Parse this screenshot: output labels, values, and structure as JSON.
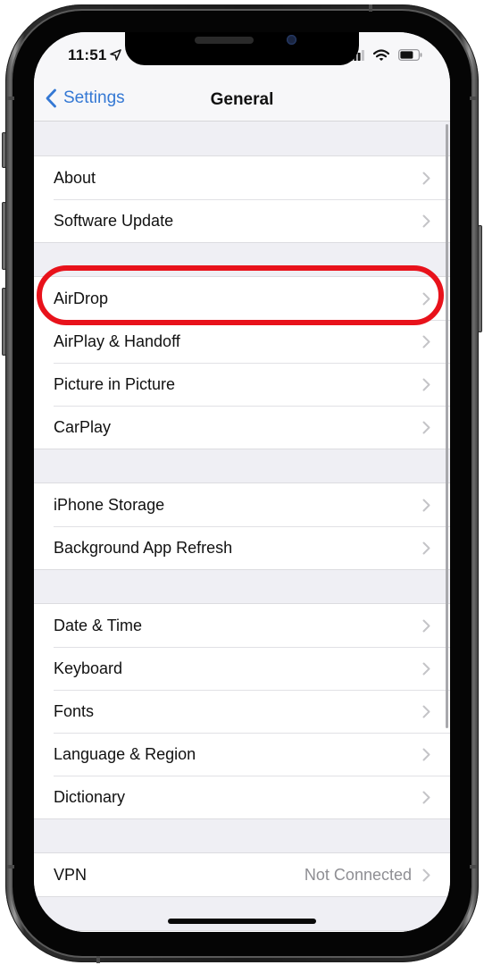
{
  "status_bar": {
    "time": "11:51",
    "location_icon": "location-arrow-icon",
    "signal_icon": "cellular-signal-icon",
    "wifi_icon": "wifi-icon",
    "battery_icon": "battery-icon"
  },
  "nav": {
    "back_label": "Settings",
    "back_icon": "chevron-left-icon",
    "title": "General"
  },
  "groups": [
    {
      "rows": [
        {
          "label": "About"
        },
        {
          "label": "Software Update"
        }
      ]
    },
    {
      "rows": [
        {
          "label": "AirDrop"
        },
        {
          "label": "AirPlay & Handoff"
        },
        {
          "label": "Picture in Picture"
        },
        {
          "label": "CarPlay"
        }
      ]
    },
    {
      "rows": [
        {
          "label": "iPhone Storage"
        },
        {
          "label": "Background App Refresh"
        }
      ]
    },
    {
      "rows": [
        {
          "label": "Date & Time"
        },
        {
          "label": "Keyboard"
        },
        {
          "label": "Fonts"
        },
        {
          "label": "Language & Region"
        },
        {
          "label": "Dictionary"
        }
      ]
    },
    {
      "rows": [
        {
          "label": "VPN",
          "value": "Not Connected"
        }
      ]
    }
  ],
  "annotation": {
    "highlighted_item": "AirDrop",
    "color": "#e8121b"
  },
  "colors": {
    "accent": "#3478d4",
    "background": "#efeff4",
    "secondary_text": "#8e8e93"
  }
}
